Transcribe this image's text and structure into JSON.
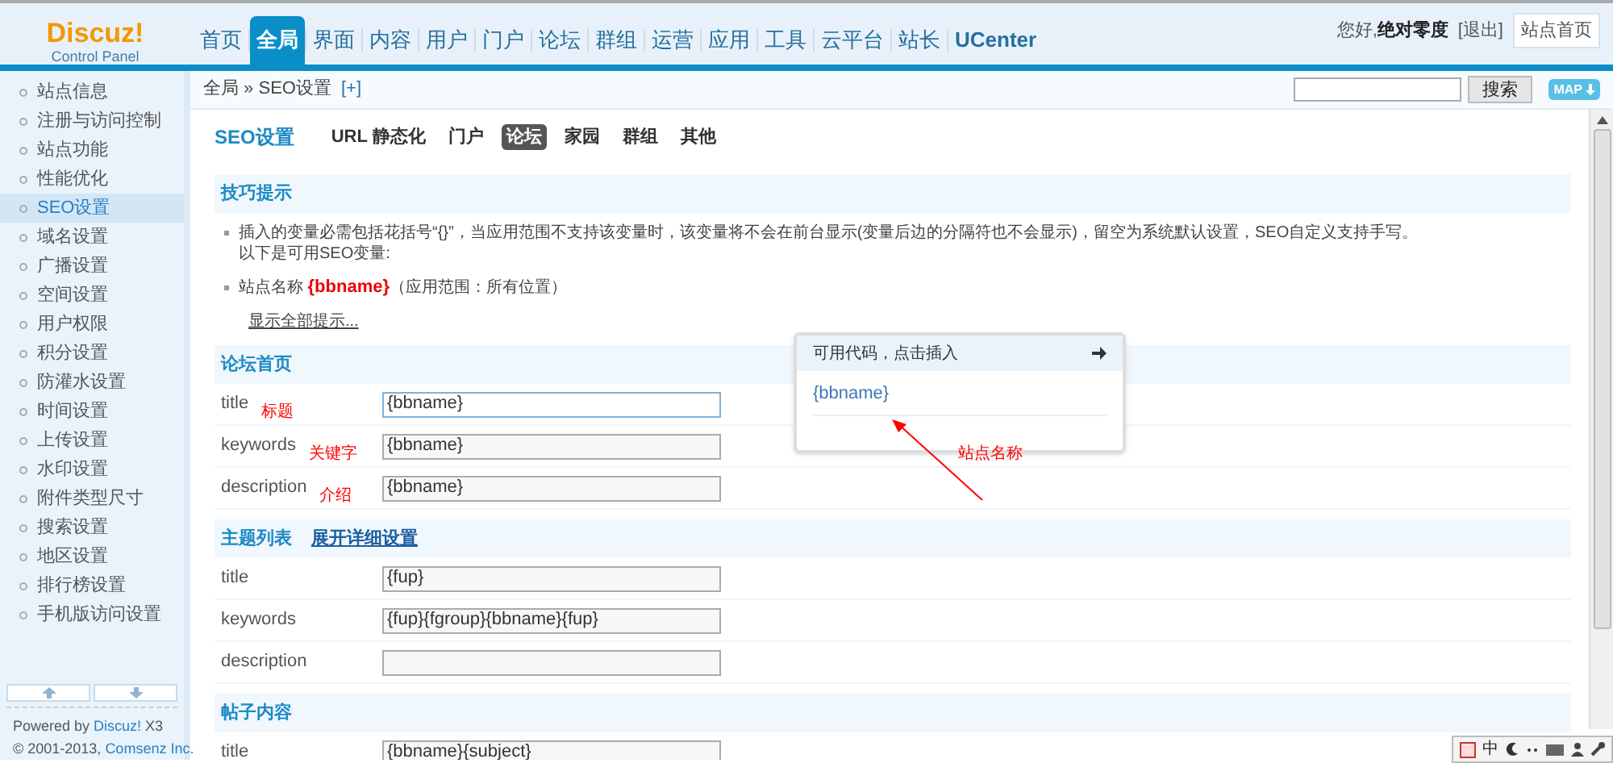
{
  "logo": {
    "name": "Discuz!",
    "subtitle": "Control Panel"
  },
  "nav": [
    {
      "label": "首页",
      "selected": false
    },
    {
      "label": "全局",
      "selected": true
    },
    {
      "label": "界面",
      "selected": false
    },
    {
      "label": "内容",
      "selected": false
    },
    {
      "label": "用户",
      "selected": false
    },
    {
      "label": "门户",
      "selected": false
    },
    {
      "label": "论坛",
      "selected": false
    },
    {
      "label": "群组",
      "selected": false
    },
    {
      "label": "运营",
      "selected": false
    },
    {
      "label": "应用",
      "selected": false
    },
    {
      "label": "工具",
      "selected": false
    },
    {
      "label": "云平台",
      "selected": false
    },
    {
      "label": "站长",
      "selected": false
    },
    {
      "label": "UCenter",
      "selected": false
    }
  ],
  "user": {
    "greeting": "您好,",
    "name": "绝对零度",
    "logout": "[退出]",
    "home_button": "站点首页"
  },
  "breadcrumb": {
    "path": "全局 » SEO设置",
    "add": "[+]"
  },
  "search": {
    "button": "搜索",
    "map": "MAP"
  },
  "sidebar": {
    "items": [
      {
        "label": "站点信息",
        "selected": false
      },
      {
        "label": "注册与访问控制",
        "selected": false
      },
      {
        "label": "站点功能",
        "selected": false
      },
      {
        "label": "性能优化",
        "selected": false
      },
      {
        "label": "SEO设置",
        "selected": true
      },
      {
        "label": "域名设置",
        "selected": false
      },
      {
        "label": "广播设置",
        "selected": false
      },
      {
        "label": "空间设置",
        "selected": false
      },
      {
        "label": "用户权限",
        "selected": false
      },
      {
        "label": "积分设置",
        "selected": false
      },
      {
        "label": "防灌水设置",
        "selected": false
      },
      {
        "label": "时间设置",
        "selected": false
      },
      {
        "label": "上传设置",
        "selected": false
      },
      {
        "label": "水印设置",
        "selected": false
      },
      {
        "label": "附件类型尺寸",
        "selected": false
      },
      {
        "label": "搜索设置",
        "selected": false
      },
      {
        "label": "地区设置",
        "selected": false
      },
      {
        "label": "排行榜设置",
        "selected": false
      },
      {
        "label": "手机版访问设置",
        "selected": false
      }
    ],
    "footer": {
      "powered_prefix": "Powered by",
      "powered_link": "Discuz!",
      "powered_suffix": "X3",
      "copyright_prefix": "© 2001-2013,",
      "copyright_link": "Comsenz Inc."
    }
  },
  "page_title": "SEO设置",
  "subtabs": [
    {
      "label": "URL 静态化",
      "selected": false
    },
    {
      "label": "门户",
      "selected": false
    },
    {
      "label": "论坛",
      "selected": true
    },
    {
      "label": "家园",
      "selected": false
    },
    {
      "label": "群组",
      "selected": false
    },
    {
      "label": "其他",
      "selected": false
    }
  ],
  "tips": {
    "heading": "技巧提示",
    "items": [
      {
        "lines": [
          "插入的变量必需包括花括号“{}”，当应用范围不支持该变量时，该变量将不会在前台显示(变量后边的分隔符也不会显示)，留空为系统默认设置，SEO自定义支持手写。",
          "以下是可用SEO变量:"
        ]
      },
      {
        "lines": [
          "站点名称 **{bbname}**（应用范围：所有位置）"
        ]
      }
    ],
    "show_all": "显示全部提示..."
  },
  "sections": [
    {
      "heading": "论坛首页",
      "rows": [
        {
          "label": "title",
          "note": "标题",
          "value": "{bbname}",
          "focused": true
        },
        {
          "label": "keywords",
          "note": "关键字",
          "value": "{bbname}",
          "focused": false
        },
        {
          "label": "description",
          "note": "介绍",
          "value": "{bbname}",
          "focused": false
        }
      ]
    },
    {
      "heading": "主题列表",
      "link": "展开详细设置",
      "rows": [
        {
          "label": "title",
          "value": "{fup}",
          "focused": false
        },
        {
          "label": "keywords",
          "value": "{fup}{fgroup}{bbname}{fup}",
          "focused": false
        },
        {
          "label": "description",
          "value": "",
          "focused": false
        }
      ]
    },
    {
      "heading": "帖子内容",
      "rows": [
        {
          "label": "title",
          "value": "{bbname}{subject}",
          "focused": false
        }
      ]
    }
  ],
  "popup": {
    "title": "可用代码，点击插入",
    "codes": [
      "{bbname}"
    ],
    "note": "站点名称"
  },
  "ime": {
    "mode": "中"
  }
}
